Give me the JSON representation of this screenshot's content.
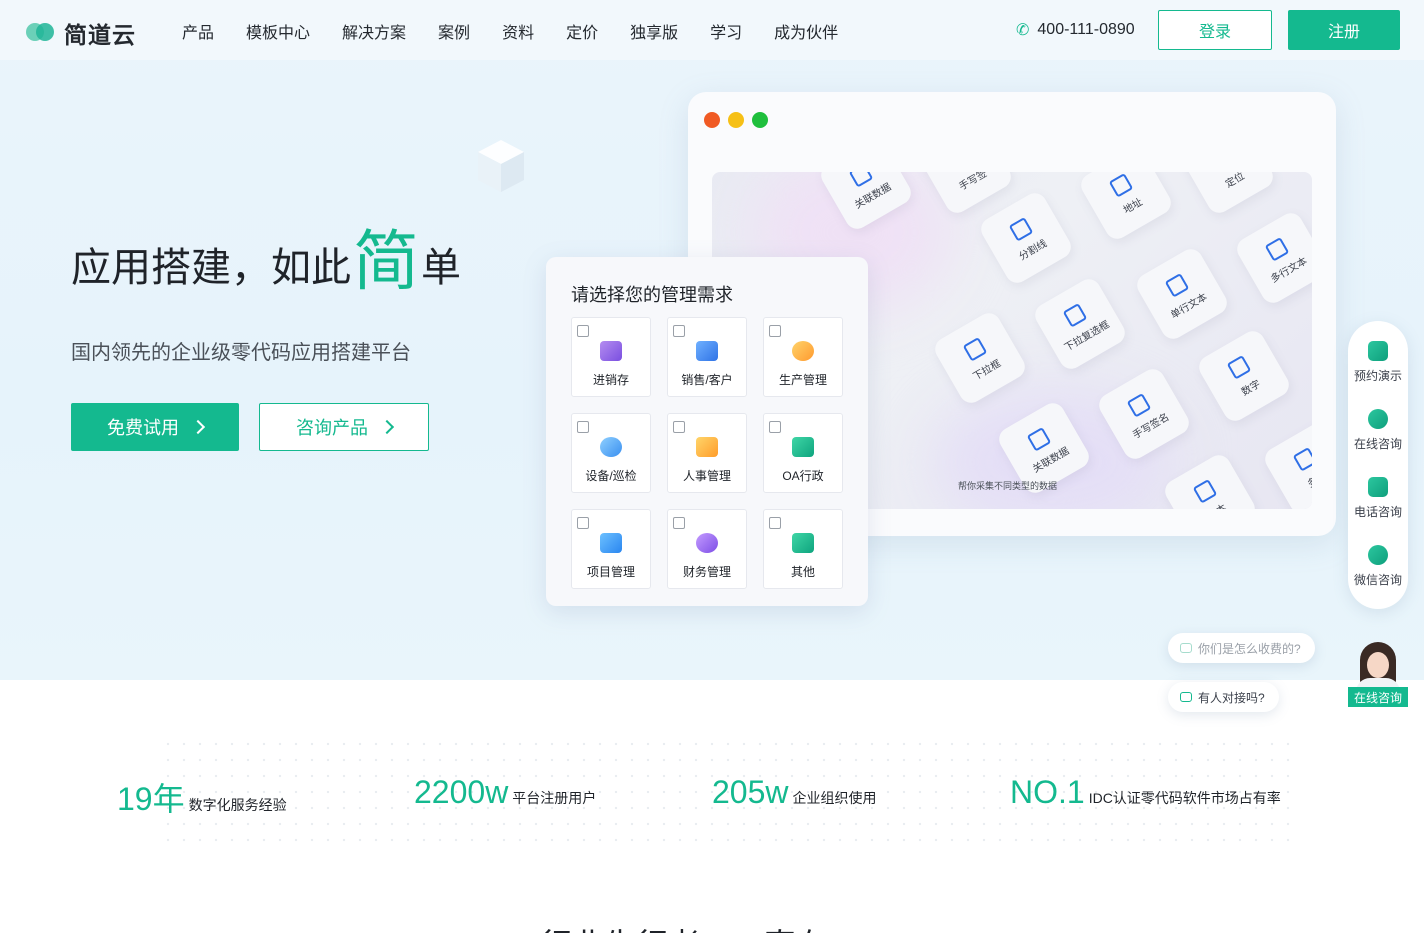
{
  "nav": {
    "logo_text": "简道云",
    "links": [
      "产品",
      "模板中心",
      "解决方案",
      "案例",
      "资料",
      "定价",
      "独享版",
      "学习",
      "成为伙伴"
    ],
    "phone": "400-111-0890",
    "login": "登录",
    "register": "注册"
  },
  "hero": {
    "title_a": "应用搭建，如此",
    "title_em": "简",
    "title_b": "单",
    "subtitle": "国内领先的企业级零代码应用搭建平台",
    "btn_try": "免费试用",
    "btn_consult": "咨询产品"
  },
  "canvas": {
    "tiles": [
      "关联数据",
      "手写签",
      "分割线",
      "地址",
      "定位",
      "多行文本",
      "单行文本",
      "下拉复选框",
      "下拉框",
      "数字",
      "手写签名",
      "关联数据",
      "多行",
      "文本"
    ],
    "note": "帮你采集不同类型的数据"
  },
  "selector": {
    "title": "请选择您的管理需求",
    "options": [
      "进销存",
      "销售/客户",
      "生产管理",
      "设备/巡检",
      "人事管理",
      "OA行政",
      "项目管理",
      "财务管理",
      "其他"
    ]
  },
  "float": {
    "items": [
      "预约演示",
      "在线咨询",
      "电话咨询",
      "微信咨询"
    ],
    "bubble1": "你们是怎么收费的?",
    "bubble2": "有人对接吗?",
    "avatar_label": "在线咨询"
  },
  "stats": [
    {
      "num": "19年",
      "desc": "数字化服务经验"
    },
    {
      "num": "2200w",
      "desc": "平台注册用户"
    },
    {
      "num": "205w",
      "desc": "企业组织使用"
    },
    {
      "num": "NO.1",
      "desc": "IDC认证零代码软件市场占有率"
    }
  ],
  "bottom_heading": "行业先行者，一直在"
}
